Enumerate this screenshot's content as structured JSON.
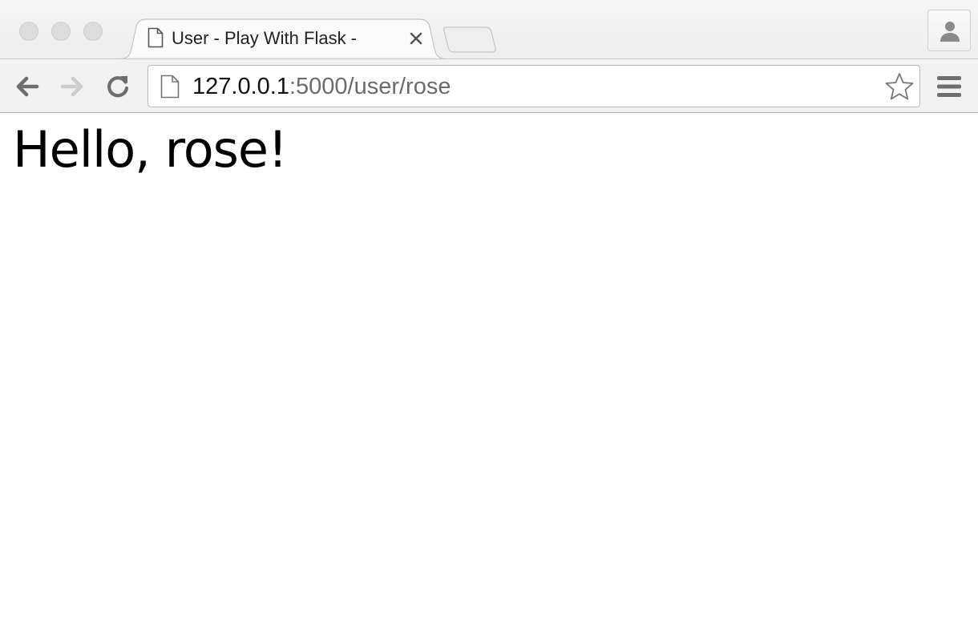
{
  "window": {
    "controls": [
      "close",
      "minimize",
      "maximize"
    ]
  },
  "tabs": [
    {
      "title": "User - Play With Flask -",
      "icon": "page-icon",
      "active": true
    }
  ],
  "toolbar": {
    "back_icon": "arrow-left-icon",
    "forward_icon": "arrow-right-icon",
    "reload_icon": "reload-icon",
    "menu_icon": "hamburger-menu-icon",
    "profile_icon": "user-profile-icon"
  },
  "address_bar": {
    "host": "127.0.0.1",
    "path": ":5000/user/rose",
    "icon": "page-icon",
    "bookmark_icon": "star-icon"
  },
  "page": {
    "heading": "Hello, rose!"
  },
  "colors": {
    "tab_strip": "#ededed",
    "toolbar": "#f2f2f2",
    "url_host": "#111111",
    "url_path": "#6b6b6b",
    "page_background": "#ffffff"
  }
}
